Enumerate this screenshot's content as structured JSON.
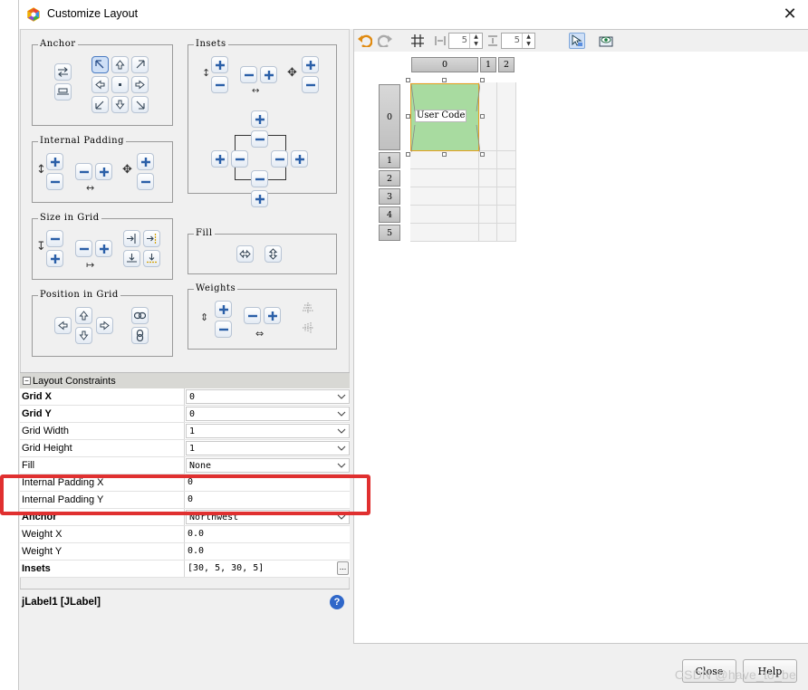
{
  "window": {
    "title": "Customize Layout",
    "close_glyph": "✕"
  },
  "groups": {
    "anchor": "Anchor",
    "insets": "Insets",
    "internal_padding": "Internal Padding",
    "size_in_grid": "Size in Grid",
    "fill": "Fill",
    "position_in_grid": "Position in Grid",
    "weights": "Weights"
  },
  "properties": {
    "section_title": "Layout Constraints",
    "rows": [
      {
        "name": "Grid X",
        "value": "0",
        "bold": true,
        "type": "combo"
      },
      {
        "name": "Grid Y",
        "value": "0",
        "bold": true,
        "type": "combo"
      },
      {
        "name": "Grid Width",
        "value": "1",
        "bold": false,
        "type": "combo"
      },
      {
        "name": "Grid Height",
        "value": "1",
        "bold": false,
        "type": "combo"
      },
      {
        "name": "Fill",
        "value": "None",
        "bold": false,
        "type": "combo"
      },
      {
        "name": "Internal Padding X",
        "value": "0",
        "bold": false,
        "type": "text"
      },
      {
        "name": "Internal Padding Y",
        "value": "0",
        "bold": false,
        "type": "text"
      },
      {
        "name": "Anchor",
        "value": "Northwest",
        "bold": true,
        "type": "combo"
      },
      {
        "name": "Weight X",
        "value": "0.0",
        "bold": false,
        "type": "text"
      },
      {
        "name": "Weight Y",
        "value": "0.0",
        "bold": false,
        "type": "text"
      },
      {
        "name": "Insets",
        "value": "[30, 5, 30, 5]",
        "bold": true,
        "type": "ellipsis"
      }
    ]
  },
  "description": {
    "title": "jLabel1 [JLabel]",
    "help_glyph": "?"
  },
  "toolbar": {
    "hgap_value": "5",
    "vgap_value": "5"
  },
  "grid": {
    "column_headers": [
      "0",
      "1",
      "2"
    ],
    "row_headers": [
      "0",
      "1",
      "2",
      "3",
      "4",
      "5"
    ],
    "component_label": "User Code"
  },
  "buttons": {
    "close": "Close",
    "help": "Help"
  },
  "watermark": "CSDN @have_to_be",
  "colors": {
    "highlight": "#e03030",
    "component_fill": "#a8dba0",
    "component_border": "#e6a01e"
  }
}
